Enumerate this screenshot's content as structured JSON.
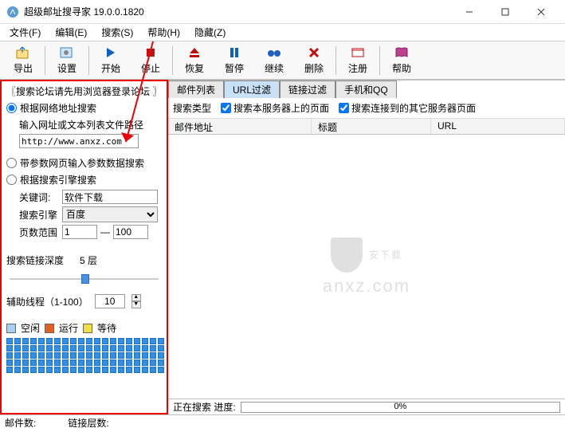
{
  "window": {
    "title": "超级邮址搜寻家 19.0.0.1820"
  },
  "menu": {
    "file": "文件(F)",
    "edit": "编辑(E)",
    "search": "搜索(S)",
    "help": "帮助(H)",
    "hide": "隐藏(Z)"
  },
  "toolbar": {
    "export": "导出",
    "settings": "设置",
    "start": "开始",
    "stop": "停止",
    "resume": "恢复",
    "pause": "暂停",
    "continue": "继续",
    "delete": "删除",
    "register": "注册",
    "helpbtn": "帮助"
  },
  "left": {
    "section_title": "〖搜索论坛请先用浏览器登录论坛 〗",
    "radio1": "根据网络地址搜索",
    "sub1": "输入网址或文本列表文件路径",
    "url_value": "http://www.anxz.com",
    "radio2": "带参数网页输入参数数据搜索",
    "radio3": "根据搜索引擎搜索",
    "keyword_label": "关键词:",
    "keyword_value": "软件下载",
    "engine_label": "搜索引擎",
    "engine_value": "百度",
    "pagerange_label": "页数范围",
    "pagerange_from": "1",
    "pagerange_to": "100",
    "range_dash": "—",
    "depth_label": "搜索链接深度",
    "depth_value": "5 层",
    "threads_label": "辅助线程（1-100）",
    "threads_value": "10",
    "legend_idle": "空闲",
    "legend_run": "运行",
    "legend_wait": "等待"
  },
  "tabs": {
    "t1": "邮件列表",
    "t2": "URL过滤",
    "t3": "链接过滤",
    "t4": "手机和QQ"
  },
  "filter": {
    "label": "搜索类型",
    "opt1": "搜索本服务器上的页面",
    "opt2": "搜索连接到的其它服务器页面"
  },
  "columns": {
    "c1": "邮件地址",
    "c2": "标题",
    "c3": "URL"
  },
  "watermark": {
    "text1": "安下载",
    "text2": "anxz.com"
  },
  "progress": {
    "label": "正在搜索  进度:",
    "percent": "0%"
  },
  "status": {
    "s1": "邮件数:",
    "s2": "链接层数:"
  }
}
